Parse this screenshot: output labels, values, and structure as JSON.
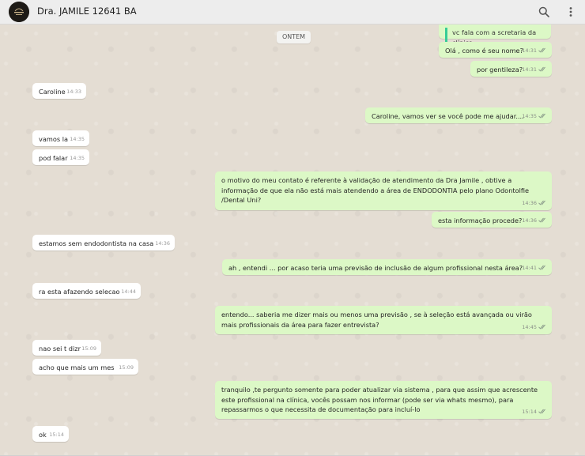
{
  "header": {
    "contact_name": "Dra. JAMILE 12641 BA",
    "avatar_icon": "clinic-logo-icon",
    "search_icon": "search-icon",
    "menu_icon": "more-vertical-icon"
  },
  "chat": {
    "date_separator": "ONTEM",
    "messages": [
      {
        "dir": "out",
        "text": "vc fala com a scretaria da clínica",
        "time": "",
        "quoted": true
      },
      {
        "dir": "out",
        "text": "Olá , como é seu nome?",
        "time": "14:31"
      },
      {
        "dir": "out",
        "text": "por gentileza?",
        "time": "14:31"
      },
      {
        "dir": "in",
        "text": "Caroline",
        "time": "14:33"
      },
      {
        "dir": "out",
        "text": "Caroline, vamos ver se você pode me ajudar....",
        "time": "14:35"
      },
      {
        "dir": "in",
        "text": "vamos la",
        "time": "14:35"
      },
      {
        "dir": "in",
        "text": "pod falar",
        "time": "14:35"
      },
      {
        "dir": "out",
        "text": "o motivo do meu contato é referente à validação de atendimento da Dra Jamile , obtive a informação de que ela não está mais atendendo a área de ENDODONTIA pelo plano Odontolfie /Dental Uni?",
        "time": "14:36"
      },
      {
        "dir": "out",
        "text": "esta informação procede?",
        "time": "14:36"
      },
      {
        "dir": "in",
        "text": "estamos sem endodontista na casa",
        "time": "14:36"
      },
      {
        "dir": "out",
        "text": "ah , entendi ... por acaso teria uma previsão de inclusão de algum profissional nesta área?",
        "time": "14:41"
      },
      {
        "dir": "in",
        "text": "ra esta afazendo selecao",
        "time": "14:44"
      },
      {
        "dir": "out",
        "text": "entendo... saberia me dizer mais ou menos uma previsão , se à seleção está avançada ou virão mais profissionais da área para fazer entrevista?",
        "time": "14:45"
      },
      {
        "dir": "in",
        "text": "nao sei t dizr",
        "time": "15:09"
      },
      {
        "dir": "in",
        "text": "acho que  mais um mes",
        "time": "15:09"
      },
      {
        "dir": "out",
        "text": "tranquilo ,te pergunto somente para poder atualizar via sistema , para que assim que acrescente este profissional na clínica, vocês possam nos informar (pode ser via whats mesmo), para repassarmos o que necessita de documentação para incluí-lo",
        "time": "15:14"
      },
      {
        "dir": "in",
        "text": "ok",
        "time": "15:14"
      }
    ]
  },
  "colors": {
    "incoming_bubble": "#ffffff",
    "outgoing_bubble": "#dcf8c6",
    "chat_background": "#e5ddd5",
    "header_background": "#ededed",
    "read_tick": "#8a9a8a"
  }
}
